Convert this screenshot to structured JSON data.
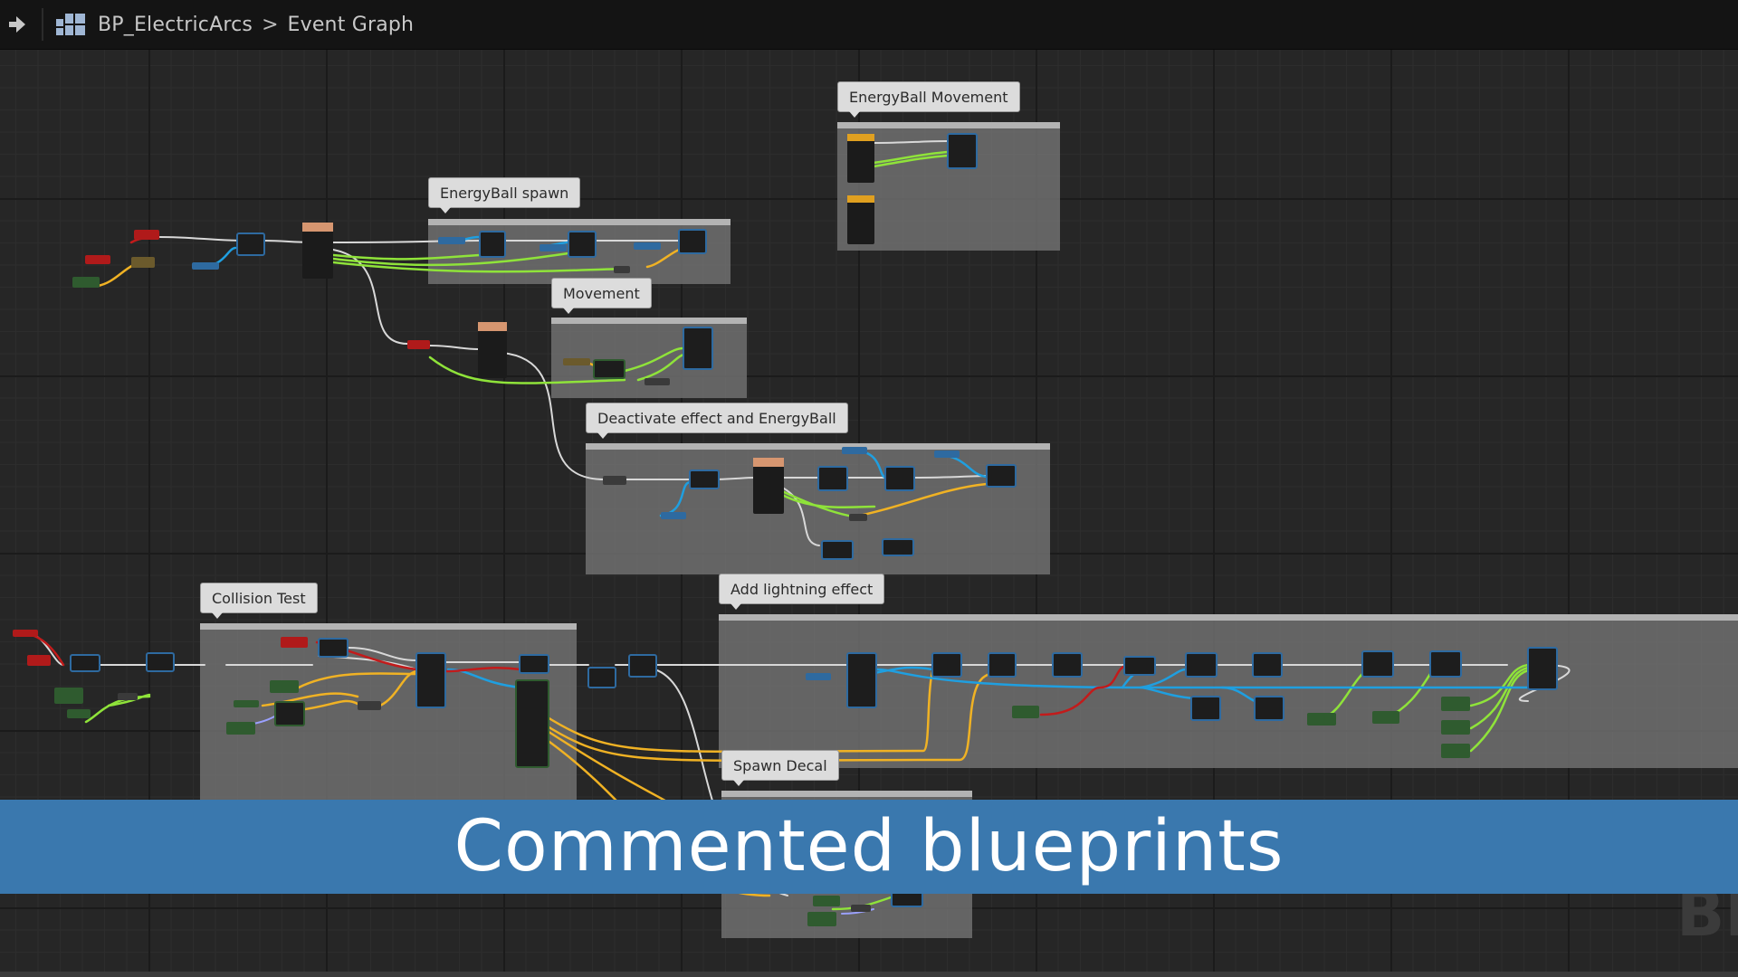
{
  "header": {
    "blueprint_name": "BP_ElectricArcs",
    "separator": ">",
    "graph_name": "Event Graph",
    "back_icon": "arrow-right-icon",
    "blueprint_icon": "blueprint-icon"
  },
  "comments": [
    {
      "id": "energyball-movement",
      "label": "EnergyBall Movement"
    },
    {
      "id": "energyball-spawn",
      "label": "EnergyBall spawn"
    },
    {
      "id": "movement",
      "label": "Movement"
    },
    {
      "id": "deactivate",
      "label": "Deactivate effect and EnergyBall"
    },
    {
      "id": "collision-test",
      "label": "Collision Test"
    },
    {
      "id": "add-lightning",
      "label": "Add lightning effect"
    },
    {
      "id": "spawn-decal",
      "label": "Spawn Decal"
    }
  ],
  "banner": {
    "text": "Commented blueprints"
  },
  "watermark": {
    "text": "BL"
  },
  "colors": {
    "background": "#262626",
    "exec_wire": "#d8d8d8",
    "green_wire": "#8fe33a",
    "yellow_wire": "#f0b224",
    "blue_wire": "#1f9fe0",
    "red_wire": "#c21b1b",
    "banner": "#3a78ae"
  }
}
